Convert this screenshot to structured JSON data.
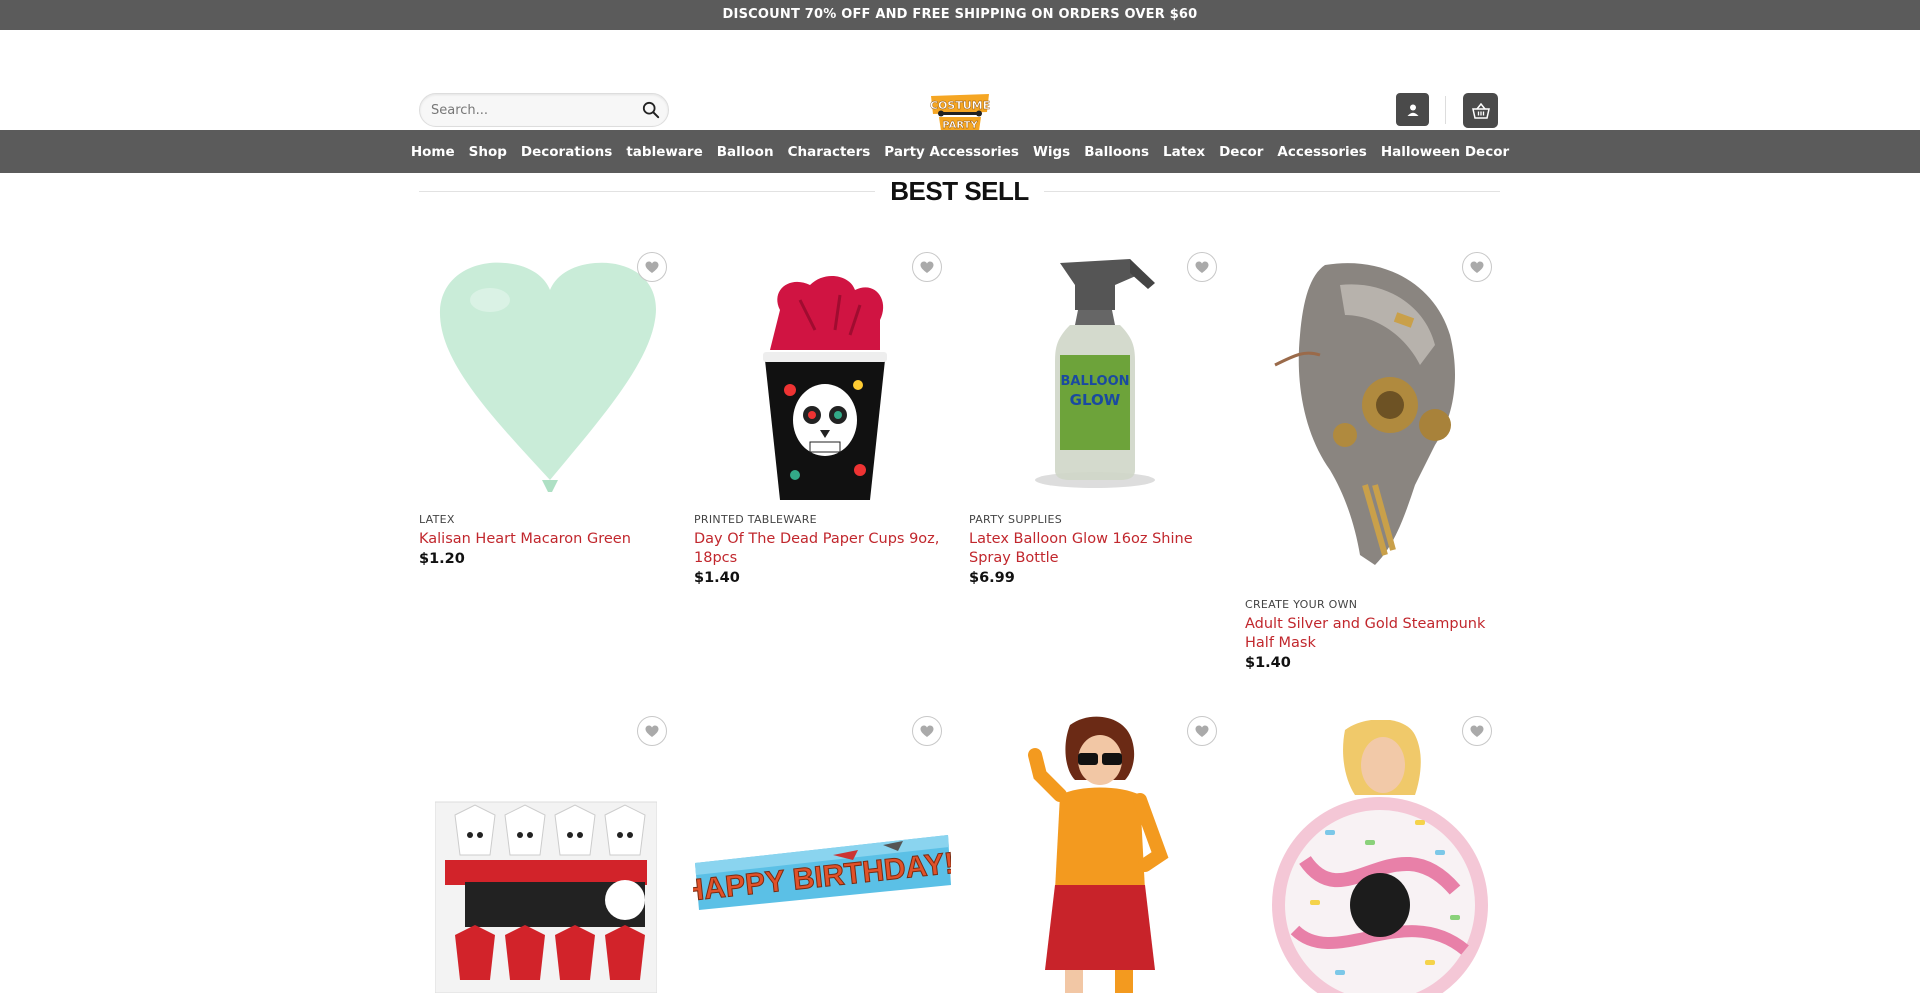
{
  "topbar": {
    "text": "DISCOUNT 70% OFF AND FREE SHIPPING ON ORDERS OVER $60"
  },
  "header": {
    "search_placeholder": "Search...",
    "logo_text_top": "COSTUME",
    "logo_text_bottom": "PARTY"
  },
  "nav": {
    "items": [
      "Home",
      "Shop",
      "Decorations",
      "tableware",
      "Balloon",
      "Characters",
      "Party Accessories",
      "Wigs",
      "Balloons",
      "Latex",
      "Decor",
      "Accessories",
      "Halloween Decor"
    ]
  },
  "section": {
    "title": "BEST SELL"
  },
  "products": [
    {
      "category": "LATEX",
      "name": "Kalisan Heart Macaron Green",
      "price": "$1.20"
    },
    {
      "category": "PRINTED TABLEWARE",
      "name": "Day Of The Dead Paper Cups 9oz, 18pcs",
      "price": "$1.40"
    },
    {
      "category": "PARTY SUPPLIES",
      "name": "Latex Balloon Glow 16oz Shine Spray Bottle",
      "price": "$6.99"
    },
    {
      "category": "CREATE YOUR OWN",
      "name": "Adult Silver and Gold Steampunk Half Mask",
      "price": "$1.40"
    }
  ],
  "banner_text": "HAPPY BIRTHDAY!",
  "colors": {
    "bar": "#5b5b5b",
    "link": "#c1272d",
    "accent": "#f5a623"
  }
}
